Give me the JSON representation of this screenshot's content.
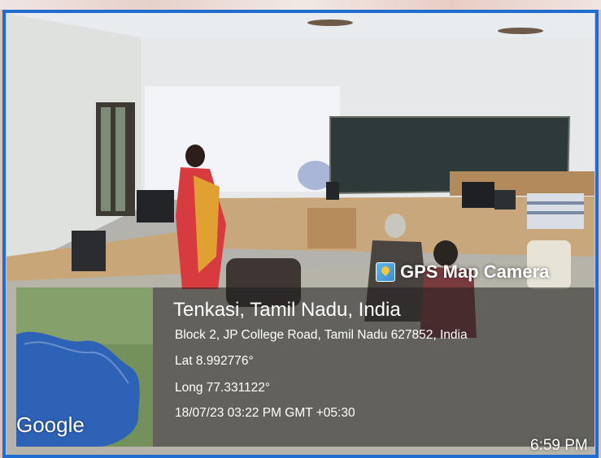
{
  "overlay": {
    "app_badge": "GPS Map Camera",
    "app_icon": "gps-map-camera-icon",
    "location_title": "Tenkasi, Tamil Nadu, India",
    "address": "Block 2, JP College Road, Tamil Nadu 627852, India",
    "latitude": "Lat 8.992776°",
    "longitude": "Long 77.331122°",
    "datetime": "18/07/23 03:22 PM GMT +05:30"
  },
  "map": {
    "attribution": "Google"
  },
  "status": {
    "clock": "6:59 PM"
  },
  "colors": {
    "selection_border": "#1f6ecf",
    "overlay_text": "#ffffff"
  }
}
